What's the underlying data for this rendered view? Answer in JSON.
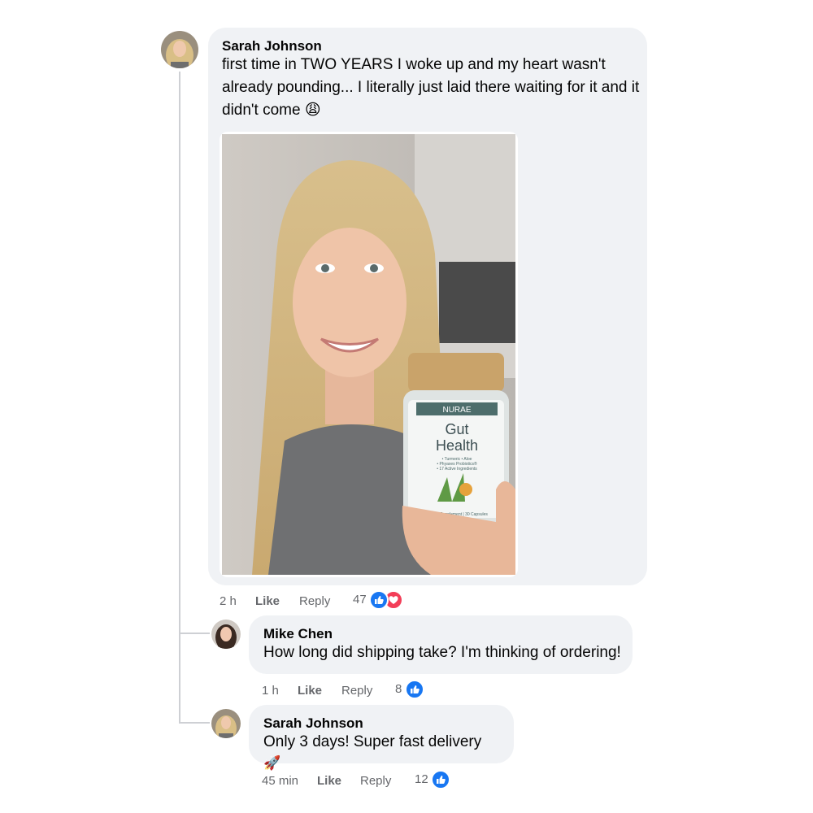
{
  "comments": [
    {
      "author": "Sarah Johnson",
      "text_lines": [
        "first time in TWO YEARS I woke up and my heart wasn't",
        "already pounding... I literally just laid there waiting for it and it",
        "didn't come 😩"
      ],
      "photo": {
        "brand": "NURAE",
        "product_line1": "Gut",
        "product_line2": "Health",
        "bullets": [
          "• Turmeric • Aloe",
          "• Phyaxes Probiotics®",
          "• 17 Active Ingredients"
        ],
        "footer": "Dietary Supplement | 30 Capsules"
      },
      "time": "2 h",
      "like_label": "Like",
      "reply_label": "Reply",
      "reaction_count": "47",
      "reactions": [
        "like-icon",
        "love-icon"
      ]
    }
  ],
  "replies": [
    {
      "author": "Mike Chen",
      "text": "How long did shipping take? I'm thinking of ordering!",
      "time": "1 h",
      "like_label": "Like",
      "reply_label": "Reply",
      "reaction_count": "8",
      "reactions": [
        "like-icon"
      ]
    },
    {
      "author": "Sarah Johnson",
      "text": "Only 3 days! Super fast delivery",
      "extra_emoji": "🚀",
      "time": "45 min",
      "like_label": "Like",
      "reply_label": "Reply",
      "reaction_count": "12",
      "reactions": [
        "like-icon"
      ]
    }
  ],
  "colors": {
    "bubble": "#f0f2f5",
    "like": "#1877f2",
    "love": "#f33e58",
    "meta": "#65676b"
  }
}
